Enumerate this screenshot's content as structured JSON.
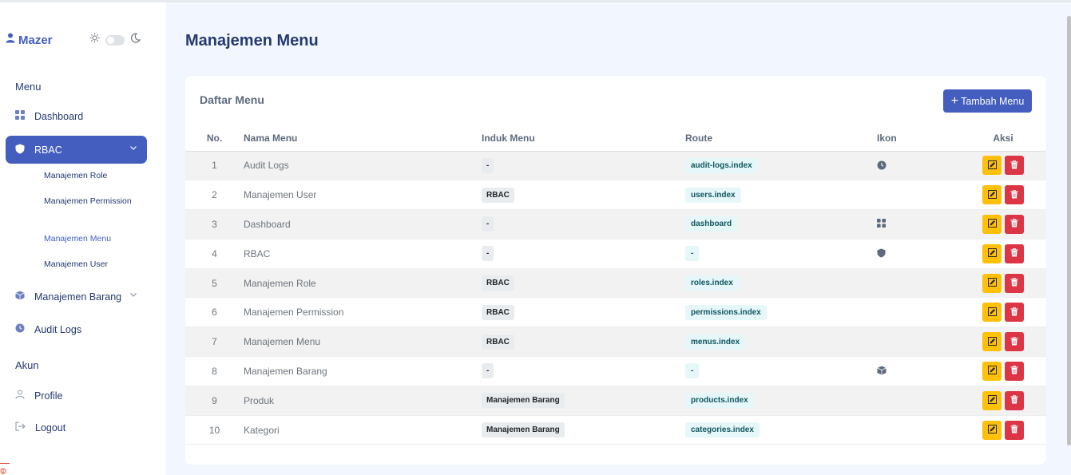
{
  "brand": {
    "name": "Mazer"
  },
  "sidebar": {
    "sections": [
      "Menu",
      "Akun"
    ],
    "items": [
      {
        "label": "Dashboard",
        "icon": "grid-icon"
      },
      {
        "label": "RBAC",
        "icon": "shield-icon",
        "active": true,
        "children": [
          "Manajemen Role",
          "Manajemen Permission",
          "Manajemen Menu",
          "Manajemen User"
        ],
        "current_child": "Manajemen Menu"
      },
      {
        "label": "Manajemen Barang",
        "icon": "box-icon"
      },
      {
        "label": "Audit Logs",
        "icon": "clock-icon"
      },
      {
        "label": "Profile",
        "icon": "person-icon"
      },
      {
        "label": "Logout",
        "icon": "logout-icon"
      }
    ]
  },
  "page": {
    "title": "Manajemen Menu"
  },
  "card": {
    "title": "Daftar Menu",
    "add_button": "Tambah Menu"
  },
  "table": {
    "headers": [
      "No.",
      "Nama Menu",
      "Induk Menu",
      "Route",
      "Ikon",
      "Aksi"
    ],
    "rows": [
      {
        "no": "1",
        "name": "Audit Logs",
        "parent": "-",
        "route": "audit-logs.index",
        "icon": "clock-icon"
      },
      {
        "no": "2",
        "name": "Manajemen User",
        "parent": "RBAC",
        "route": "users.index",
        "icon": ""
      },
      {
        "no": "3",
        "name": "Dashboard",
        "parent": "-",
        "route": "dashboard",
        "icon": "grid-icon"
      },
      {
        "no": "4",
        "name": "RBAC",
        "parent": "-",
        "route": "-",
        "icon": "shield-icon"
      },
      {
        "no": "5",
        "name": "Manajemen Role",
        "parent": "RBAC",
        "route": "roles.index",
        "icon": ""
      },
      {
        "no": "6",
        "name": "Manajemen Permission",
        "parent": "RBAC",
        "route": "permissions.index",
        "icon": ""
      },
      {
        "no": "7",
        "name": "Manajemen Menu",
        "parent": "RBAC",
        "route": "menus.index",
        "icon": ""
      },
      {
        "no": "8",
        "name": "Manajemen Barang",
        "parent": "-",
        "route": "-",
        "icon": "box-icon"
      },
      {
        "no": "9",
        "name": "Produk",
        "parent": "Manajemen Barang",
        "route": "products.index",
        "icon": ""
      },
      {
        "no": "10",
        "name": "Kategori",
        "parent": "Manajemen Barang",
        "route": "categories.index",
        "icon": ""
      }
    ]
  },
  "colors": {
    "primary": "#435ebe",
    "warning": "#ffc107",
    "danger": "#dc3545",
    "background": "#f2f7ff"
  }
}
